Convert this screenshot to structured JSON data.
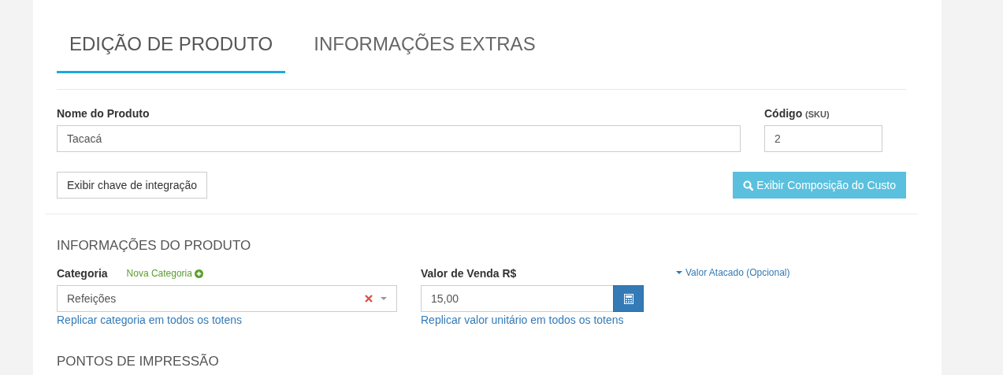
{
  "tabs": [
    {
      "label": "EDIÇÃO DE PRODUTO",
      "selected": true
    },
    {
      "label": "INFORMAÇÕES EXTRAS",
      "selected": false
    }
  ],
  "product_name": {
    "label": "Nome do Produto",
    "value": "Tacacá"
  },
  "code": {
    "label": "Código",
    "hint": "(SKU)",
    "value": "2"
  },
  "integration_key_button": "Exibir chave de integração",
  "cost_button": "Exibir Composição do Custo",
  "product_info": {
    "heading": "INFORMAÇÕES DO PRODUTO",
    "category": {
      "label": "Categoria",
      "new_link": "Nova Categoria",
      "value": "Refeições",
      "replicate_link": "Replicar categoria em todos os totens"
    },
    "price": {
      "label": "Valor de Venda R$",
      "value": "15,00",
      "replicate_link": "Replicar valor unitário em todos os totens"
    },
    "wholesale_link": "Valor Atacado (Opcional)"
  },
  "print_points": {
    "heading": "PONTOS DE IMPRESSÃO"
  }
}
